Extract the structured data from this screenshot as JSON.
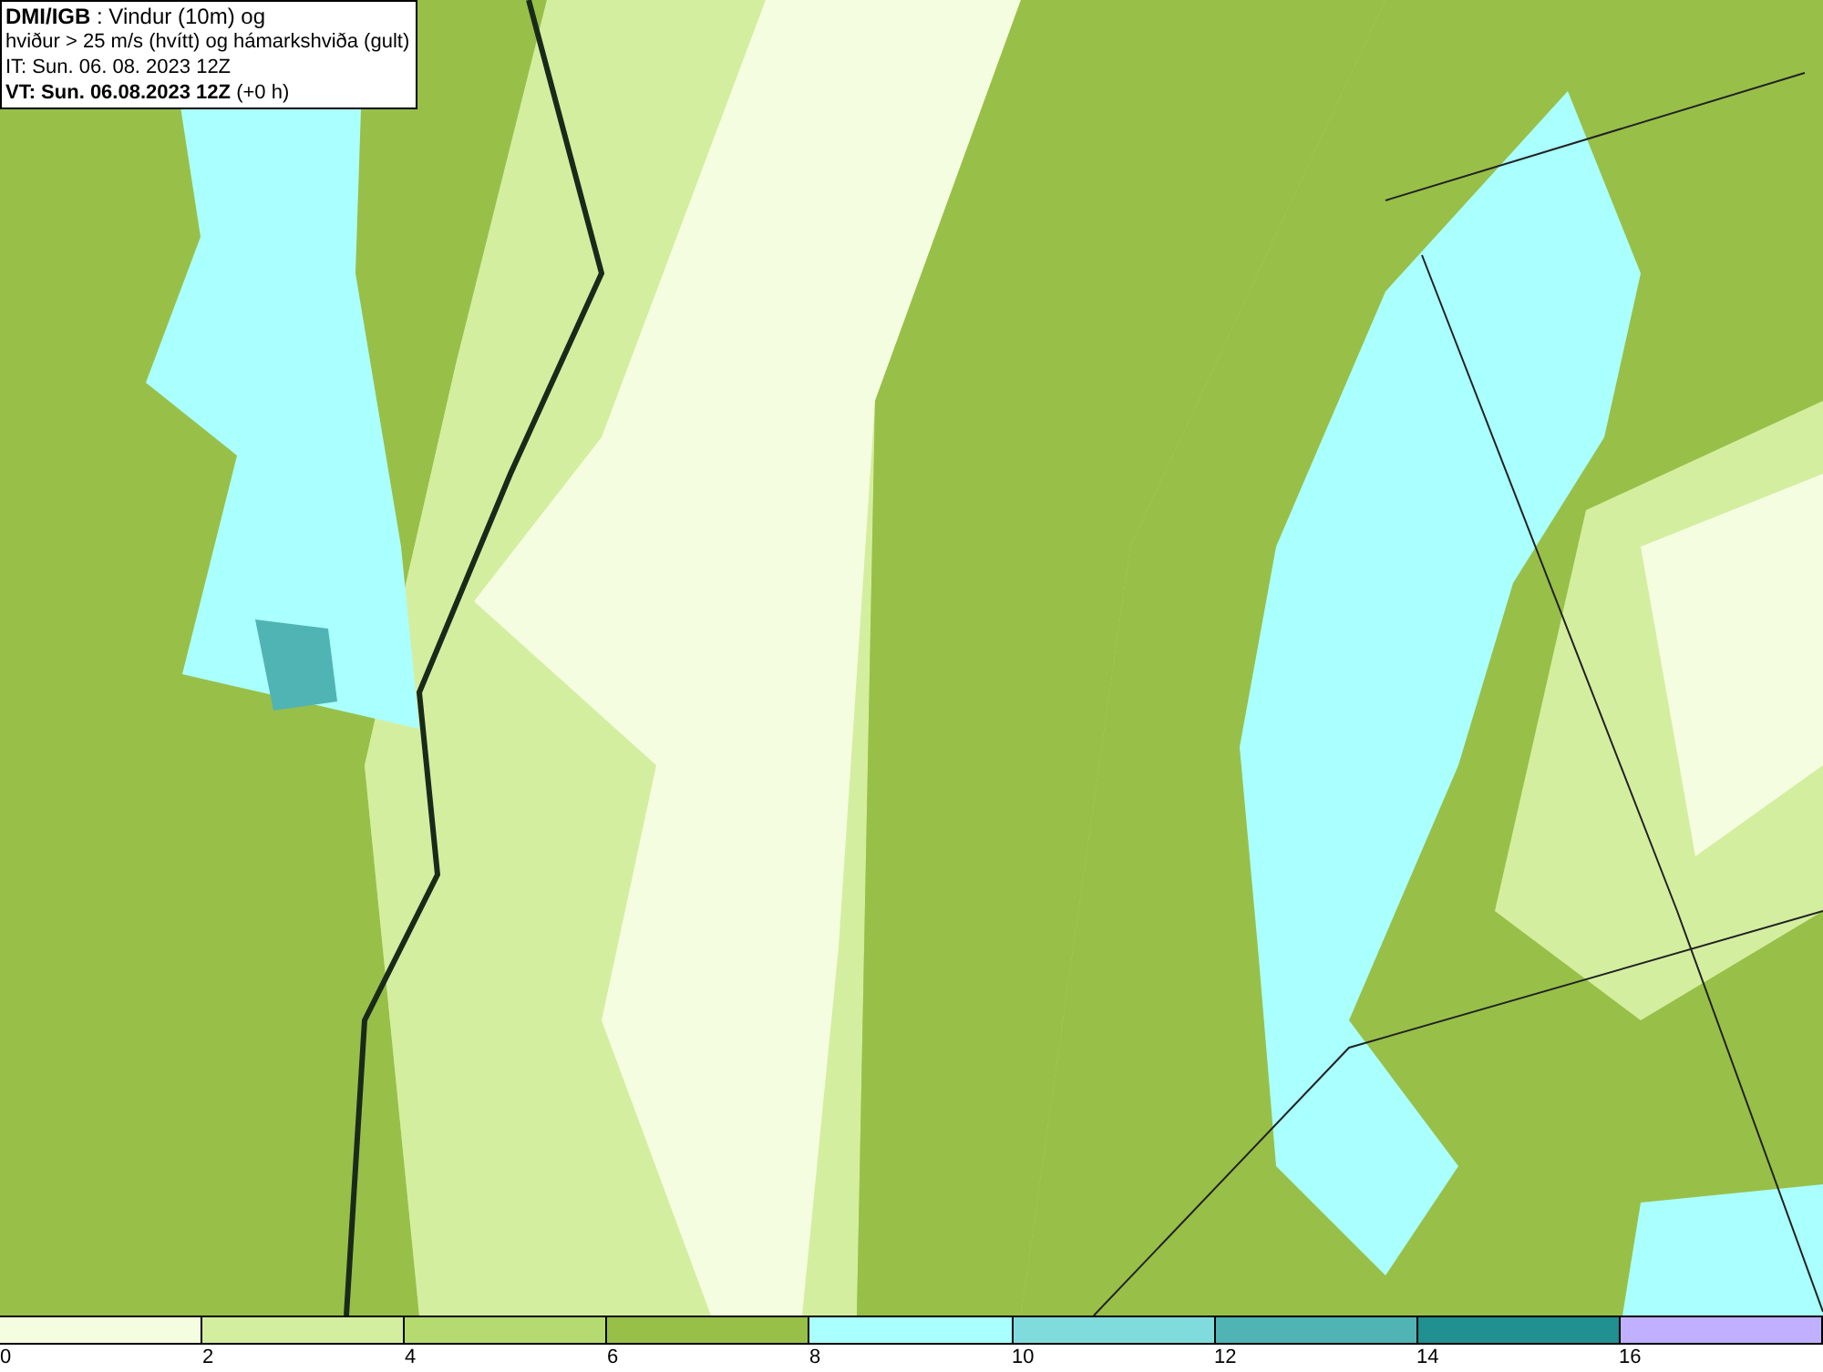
{
  "title_box": {
    "lines": [
      "**DMI/IGB** : Vindur (10m) og",
      "hviður > 25 m/s (hvítt) og hámarkshviða (gult)",
      "IT: Sun. 06. 08. 2023 12Z",
      "**VT: Sun. 06.08.2023 12Z** (+0 h)"
    ]
  },
  "legend": {
    "segments": [
      {
        "color": "#f5fde0"
      },
      {
        "color": "#d4eea0"
      },
      {
        "color": "#b5da70"
      },
      {
        "color": "#98c048"
      },
      {
        "color": "#aaffff"
      },
      {
        "color": "#80dcdc"
      },
      {
        "color": "#50b4b4"
      },
      {
        "color": "#209090"
      },
      {
        "color": "#c0b0ff"
      }
    ],
    "ticks": [
      "0",
      "2",
      "4",
      "6",
      "8",
      "10",
      "12",
      "14",
      "16"
    ]
  }
}
